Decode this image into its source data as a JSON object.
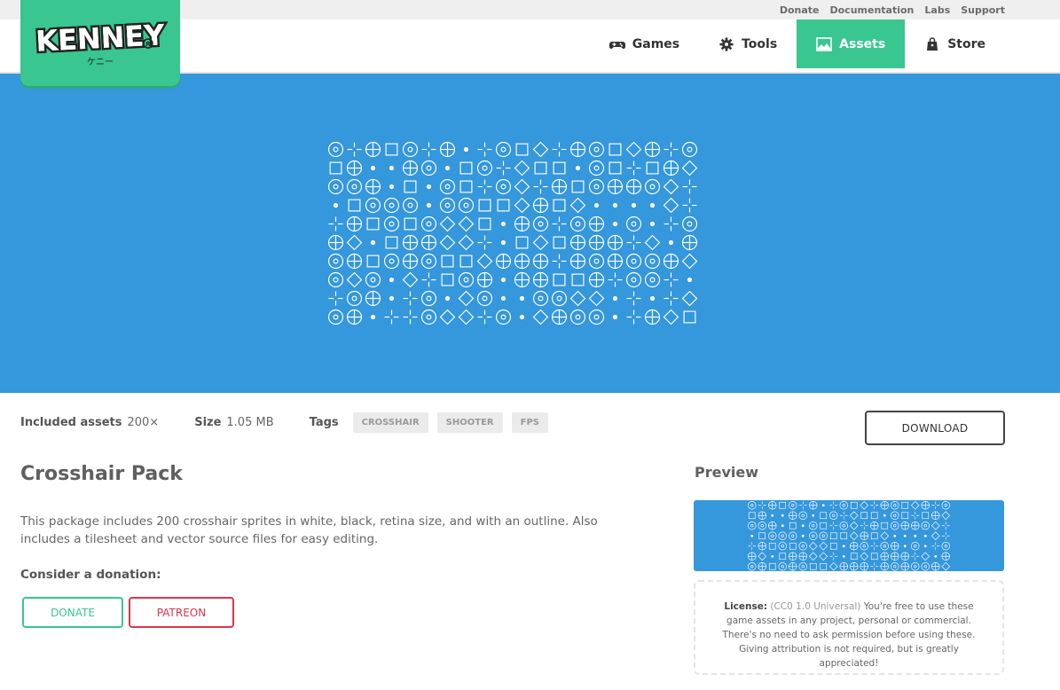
{
  "top_links": [
    "Donate",
    "Documentation",
    "Labs",
    "Support"
  ],
  "logo": {
    "text": "KENNEY",
    "sub": "ケニー"
  },
  "nav": [
    {
      "label": "Games",
      "icon": "gamepad-icon"
    },
    {
      "label": "Tools",
      "icon": "gear-icon"
    },
    {
      "label": "Assets",
      "icon": "image-icon",
      "active": true
    },
    {
      "label": "Store",
      "icon": "bag-icon"
    }
  ],
  "meta": {
    "included_label": "Included assets",
    "included_value": "200×",
    "size_label": "Size",
    "size_value": "1.05 MB",
    "tags_label": "Tags",
    "tags": [
      "CROSSHAIR",
      "SHOOTER",
      "FPS"
    ]
  },
  "download_label": "DOWNLOAD",
  "title": "Crosshair Pack",
  "description": "This package includes 200 crosshair sprites in white, black, retina size, and with an outline. Also includes a tilesheet and vector source files for easy editing.",
  "donation_heading": "Consider a donation:",
  "donate_label": "DONATE",
  "patreon_label": "PATREON",
  "preview_heading": "Preview",
  "license": {
    "label": "License:",
    "type": "(CC0 1.0 Universal)",
    "text": "You're free to use these game assets in any project, personal or commercial. There's no need to ask permission before using these. Giving attribution is not required, but is greatly appreciated!"
  },
  "colors": {
    "brand": "#39c690",
    "hero": "#3597dc",
    "patreon": "#e0334a"
  }
}
